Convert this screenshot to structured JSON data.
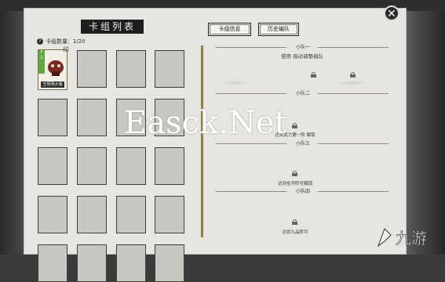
{
  "panel": {
    "title": "卡组列表",
    "count_label": "卡组数量：1/20",
    "help_icon": "question-icon"
  },
  "card": {
    "level": "1",
    "badge": "F",
    "name": "王阳明大儒"
  },
  "buttons": {
    "deck_info": "卡组信息",
    "formation": "历史编队"
  },
  "groups": [
    {
      "title": "小队一"
    },
    {
      "title": "小队二"
    },
    {
      "title": "小队三"
    },
    {
      "title": "小队四"
    },
    {
      "title": "小队五"
    }
  ],
  "hint": "使用 拖动调整编队",
  "unlock_texts": [
    "达到武力第一阶 解锁",
    "达到将军阶解锁",
    "达到全开阶可解锁",
    "达到九品阶可"
  ],
  "close_icon": "close-icon",
  "lock_icon": "lock-icon",
  "watermark": "Easck.Net",
  "logo_text": "九游"
}
